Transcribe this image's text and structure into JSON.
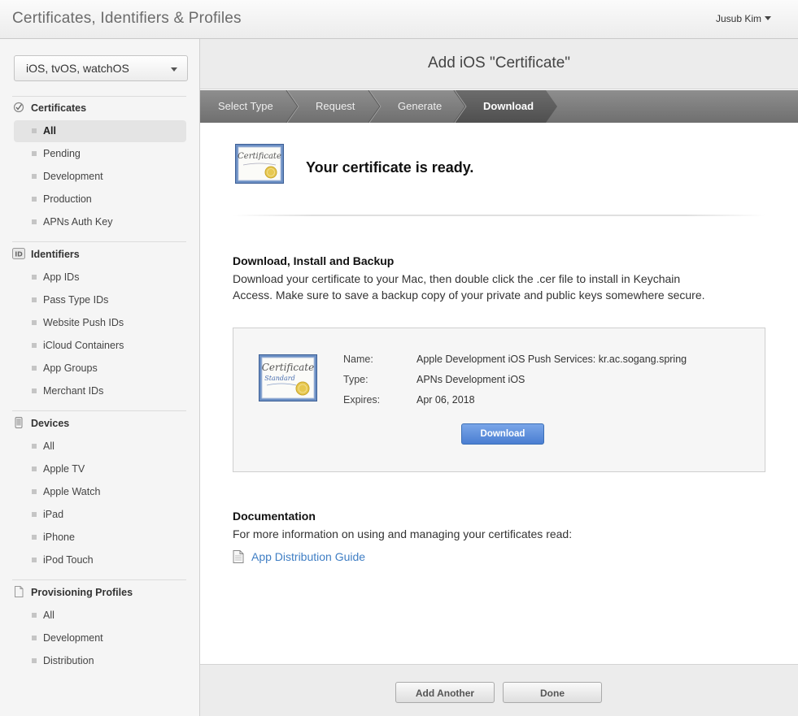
{
  "app": {
    "title": "Certificates, Identifiers & Profiles",
    "user": "Jusub Kim"
  },
  "sidebar": {
    "platform": "iOS, tvOS, watchOS",
    "sections": {
      "certificates": {
        "title": "Certificates",
        "items": [
          "All",
          "Pending",
          "Development",
          "Production",
          "APNs Auth Key"
        ]
      },
      "identifiers": {
        "title": "Identifiers",
        "items": [
          "App IDs",
          "Pass Type IDs",
          "Website Push IDs",
          "iCloud Containers",
          "App Groups",
          "Merchant IDs"
        ]
      },
      "devices": {
        "title": "Devices",
        "items": [
          "All",
          "Apple TV",
          "Apple Watch",
          "iPad",
          "iPhone",
          "iPod Touch"
        ]
      },
      "profiles": {
        "title": "Provisioning Profiles",
        "items": [
          "All",
          "Development",
          "Distribution"
        ]
      }
    },
    "identifiers_badge": "ID"
  },
  "main": {
    "title": "Add iOS \"Certificate\"",
    "steps": [
      "Select Type",
      "Request",
      "Generate",
      "Download"
    ],
    "ready_text": "Your certificate is ready.",
    "download_section": {
      "heading": "Download, Install and Backup",
      "line1": "Download your certificate to your Mac, then double click the .cer file to install in Keychain",
      "line2": "Access. Make sure to save a backup copy of your private and public keys somewhere secure."
    },
    "certificate": {
      "name_label": "Name:",
      "name_value": "Apple Development iOS Push Services: kr.ac.sogang.spring",
      "type_label": "Type:",
      "type_value": "APNs Development iOS",
      "expires_label": "Expires:",
      "expires_value": "Apr 06, 2018",
      "download_label": "Download",
      "icon_text_1": "Certificate",
      "icon_text_2": "Standard"
    },
    "documentation": {
      "heading": "Documentation",
      "text": "For more information on using and managing your certificates read:",
      "link": "App Distribution Guide"
    }
  },
  "footer": {
    "add_another": "Add Another",
    "done": "Done"
  },
  "colors": {
    "link": "#3f7ec4",
    "primary_button": "#4a7ed2",
    "step_bar": "#7a7a7a",
    "step_active": "#5c5c5c"
  }
}
